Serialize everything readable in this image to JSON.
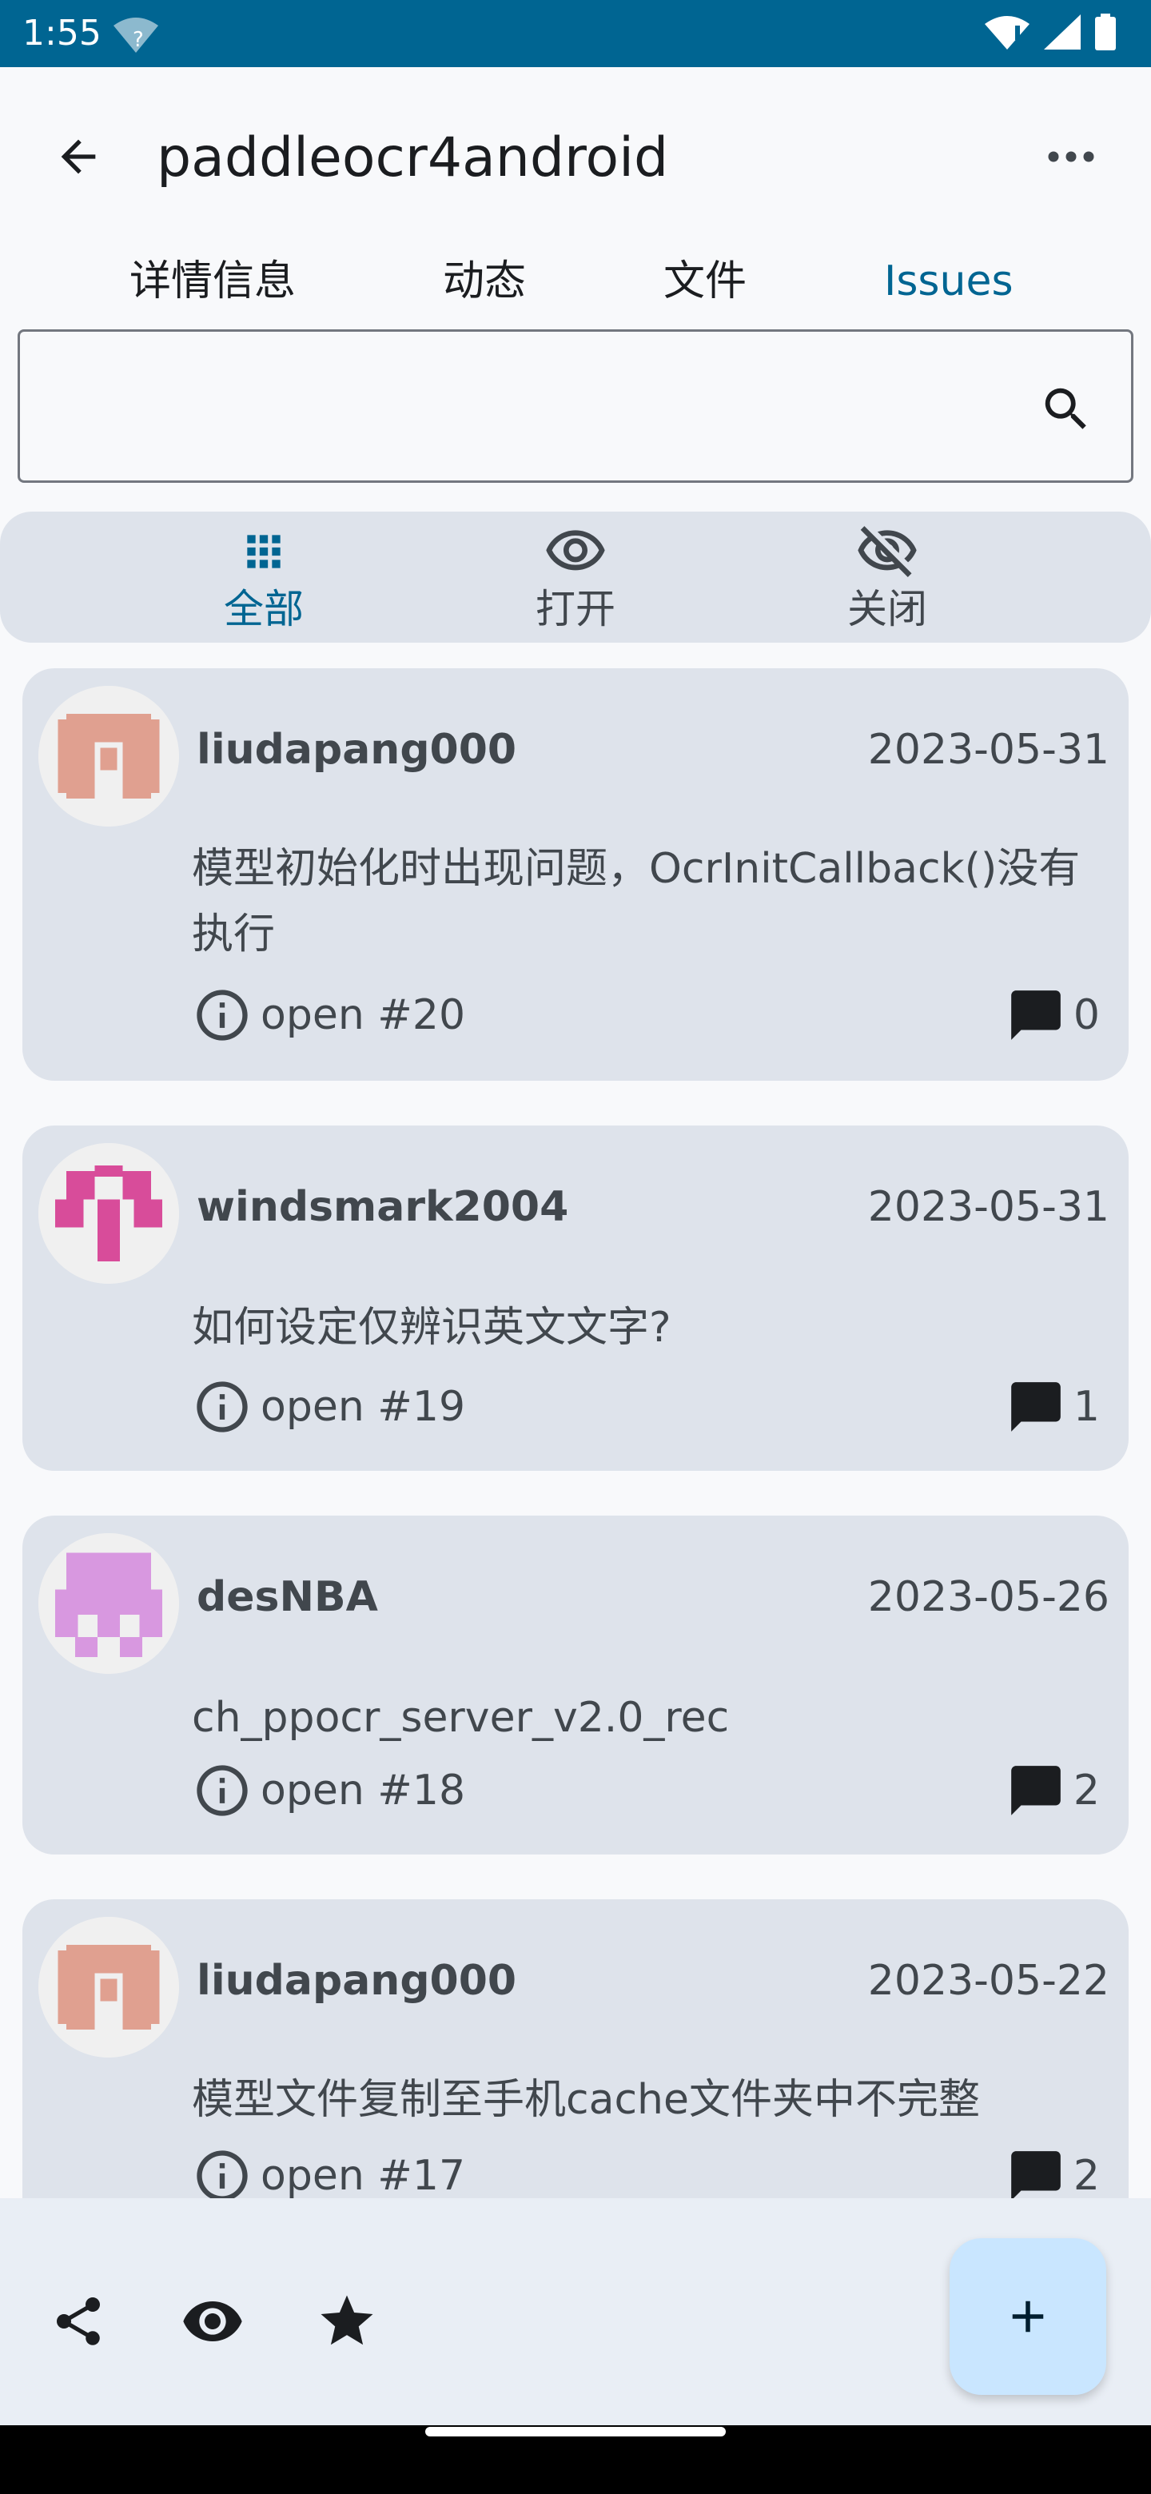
{
  "status_bar": {
    "time": "1:55",
    "wifi_unknown_mark": "?",
    "icons": [
      "wifi-alert-icon",
      "signal-icon",
      "battery-icon"
    ]
  },
  "app_bar": {
    "title": "paddleocr4android",
    "back_icon": "arrow-back-icon",
    "more_icon": "more-horizontal-icon"
  },
  "tabs": [
    {
      "label": "详情信息",
      "active": false
    },
    {
      "label": "动态",
      "active": false
    },
    {
      "label": "文件",
      "active": false
    },
    {
      "label": "Issues",
      "active": true
    }
  ],
  "search": {
    "value": "",
    "placeholder": "",
    "icon": "search-icon"
  },
  "filters": [
    {
      "label": "全部",
      "icon": "apps-grid-icon",
      "active": true
    },
    {
      "label": "打开",
      "icon": "eye-icon",
      "active": false
    },
    {
      "label": "关闭",
      "icon": "eye-off-icon",
      "active": false
    }
  ],
  "issues": [
    {
      "user": "liudapang000",
      "date": "2023-05-31",
      "title": "模型初始化时出现问题，OcrInitCallback()没有执行",
      "status": "open #20",
      "comments": "0",
      "avatar_color": "#e0a090"
    },
    {
      "user": "windsmark2004",
      "date": "2023-05-31",
      "title": "如何设定仅辨识英文文字?",
      "status": "open #19",
      "comments": "1",
      "avatar_color": "#d84c9a"
    },
    {
      "user": "desNBA",
      "date": "2023-05-26",
      "title": "ch_ppocr_server_v2.0_rec",
      "status": "open #18",
      "comments": "2",
      "avatar_color": "#d898e0"
    },
    {
      "user": "liudapang000",
      "date": "2023-05-22",
      "title": "模型文件复制至手机cache文件夹中不完整",
      "status": "open #17",
      "comments": "2",
      "avatar_color": "#e0a090"
    }
  ],
  "bottom_bar": {
    "icons": [
      "share-icon",
      "eye-icon",
      "star-icon"
    ],
    "fab_icon": "plus-icon"
  },
  "colors": {
    "status_bar": "#006592",
    "accent": "#006592",
    "card_bg": "#dee3eb",
    "fab_bg": "#c9e6ff"
  }
}
